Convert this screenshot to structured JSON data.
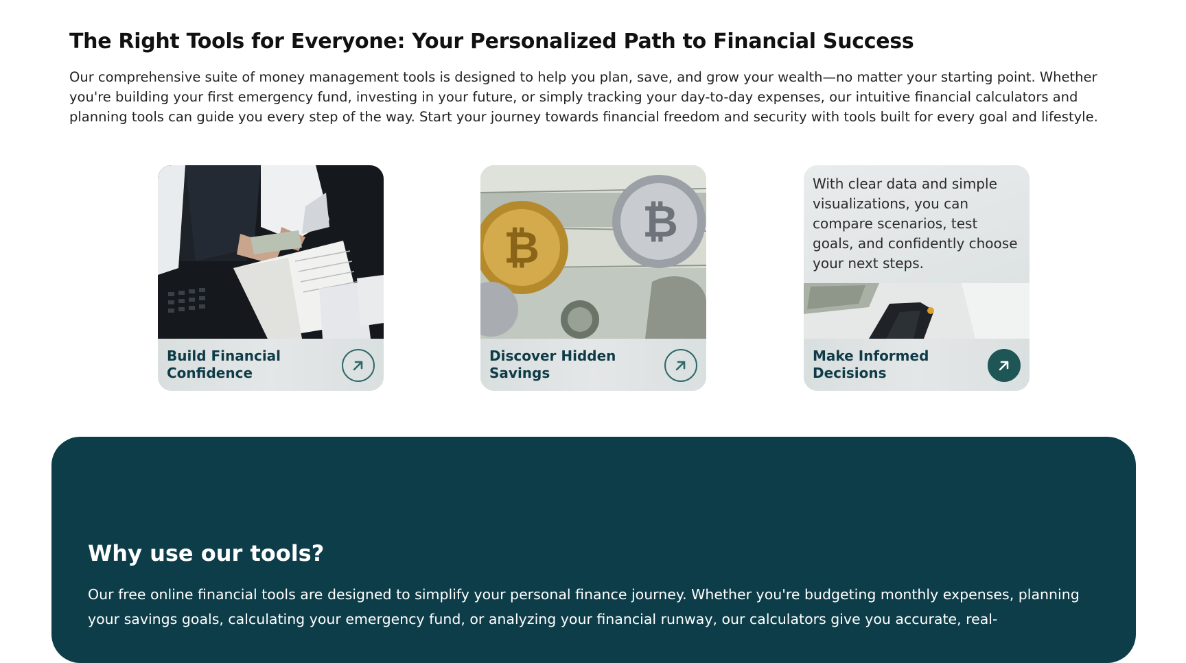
{
  "intro": {
    "title": "The Right Tools for Everyone: Your Personalized Path to Financial Success",
    "body": "Our comprehensive suite of money management tools is designed to help you plan, save, and grow your wealth—no matter your starting point. Whether you're building your first emergency fund, investing in your future, or simply tracking your day-to-day expenses, our intuitive financial calculators and planning tools can guide you every step of the way. Start your journey towards financial freedom and security with tools built for every goal and lifestyle."
  },
  "cards": [
    {
      "title": "Build Financial Confidence",
      "icon": "arrow-up-right-icon"
    },
    {
      "title": "Discover Hidden Savings",
      "icon": "arrow-up-right-icon"
    },
    {
      "title": "Make Informed Decisions",
      "description": "With clear data and simple visualizations, you can compare scenarios, test goals, and confidently choose your next steps.",
      "icon": "arrow-up-right-icon"
    }
  ],
  "why": {
    "title": "Why use our tools?",
    "body": "Our free online financial tools are designed to simplify your personal finance journey. Whether you're budgeting monthly expenses, planning your savings goals, calculating your emergency fund, or analyzing your financial runway, our calculators give you accurate, real-"
  },
  "colors": {
    "accent": "#0d3d49",
    "card_title": "#0e3b47",
    "arrow": "#2e6868",
    "arrow_filled": "#1e5656"
  }
}
